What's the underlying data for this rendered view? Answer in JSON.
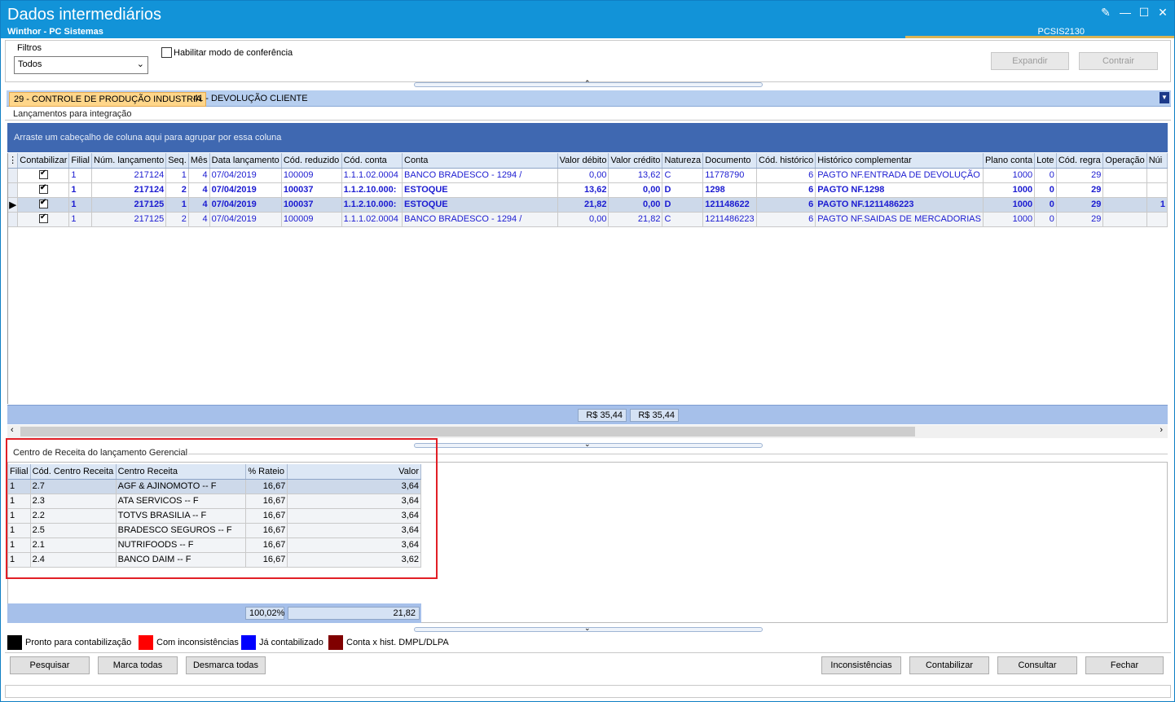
{
  "window": {
    "title": "Dados intermediários",
    "subtitle": "Winthor - PC Sistemas",
    "code": "PCSIS2130"
  },
  "filters": {
    "label": "Filtros",
    "value": "Todos",
    "conference_label": "Habilitar modo de conferência"
  },
  "top_buttons": {
    "expand": "Expandir",
    "collapse": "Contrair"
  },
  "tabs": [
    "29 - CONTROLE DE PRODUÇÃO INDUSTRIA",
    "41 - DEVOLUÇÃO CLIENTE"
  ],
  "main": {
    "section_label": "Lançamentos para integração",
    "group_hint": "Arraste um cabeçalho de coluna aqui para agrupar por essa coluna",
    "columns": [
      "Contabilizar",
      "Filial",
      "Núm. lançamento",
      "Seq.",
      "Mês",
      "Data lançamento",
      "Cód. reduzido",
      "Cód. conta",
      "Conta",
      "Valor débito",
      "Valor crédito",
      "Natureza",
      "Documento",
      "Cód. histórico",
      "Histórico complementar",
      "Plano conta",
      "Lote",
      "Cód. regra",
      "Operação",
      "Núi"
    ],
    "rows": [
      {
        "filial": "1",
        "num": "217124",
        "seq": "1",
        "mes": "4",
        "data": "07/04/2019",
        "codred": "100009",
        "codconta": "1.1.1.02.0004",
        "conta": "BANCO BRADESCO - 1294 /",
        "debito": "0,00",
        "credito": "13,62",
        "natureza": "C",
        "documento": "11778790",
        "codhist": "6",
        "hist": "PAGTO NF.ENTRADA DE DEVOLUÇÃO",
        "plano": "1000",
        "lote": "0",
        "regra": "29",
        "operacao": "",
        "nu": ""
      },
      {
        "filial": "1",
        "num": "217124",
        "seq": "2",
        "mes": "4",
        "data": "07/04/2019",
        "codred": "100037",
        "codconta": "1.1.2.10.000:",
        "conta": "ESTOQUE",
        "debito": "13,62",
        "credito": "0,00",
        "natureza": "D",
        "documento": "1298",
        "codhist": "6",
        "hist": "PAGTO NF.1298",
        "plano": "1000",
        "lote": "0",
        "regra": "29",
        "operacao": "",
        "nu": ""
      },
      {
        "filial": "1",
        "num": "217125",
        "seq": "1",
        "mes": "4",
        "data": "07/04/2019",
        "codred": "100037",
        "codconta": "1.1.2.10.000:",
        "conta": "ESTOQUE",
        "debito": "21,82",
        "credito": "0,00",
        "natureza": "D",
        "documento": "121148622",
        "codhist": "6",
        "hist": "PAGTO NF.1211486223",
        "plano": "1000",
        "lote": "0",
        "regra": "29",
        "operacao": "",
        "nu": "1"
      },
      {
        "filial": "1",
        "num": "217125",
        "seq": "2",
        "mes": "4",
        "data": "07/04/2019",
        "codred": "100009",
        "codconta": "1.1.1.02.0004",
        "conta": "BANCO BRADESCO - 1294 /",
        "debito": "0,00",
        "credito": "21,82",
        "natureza": "C",
        "documento": "1211486223",
        "codhist": "6",
        "hist": "PAGTO NF.SAIDAS DE MERCADORIAS",
        "plano": "1000",
        "lote": "0",
        "regra": "29",
        "operacao": "",
        "nu": ""
      }
    ],
    "total_debito": "R$ 35,44",
    "total_credito": "R$ 35,44"
  },
  "centro": {
    "section_label": "Centro de Receita do lançamento Gerencial",
    "columns": [
      "Filial",
      "Cód. Centro Receita",
      "Centro Receita",
      "% Rateio",
      "Valor"
    ],
    "rows": [
      {
        "filial": "1",
        "cod": "2.7",
        "nome": "AGF & AJINOMOTO -- F",
        "rateio": "16,67",
        "valor": "3,64"
      },
      {
        "filial": "1",
        "cod": "2.3",
        "nome": "ATA SERVICOS -- F",
        "rateio": "16,67",
        "valor": "3,64"
      },
      {
        "filial": "1",
        "cod": "2.2",
        "nome": "TOTVS BRASILIA -- F",
        "rateio": "16,67",
        "valor": "3,64"
      },
      {
        "filial": "1",
        "cod": "2.5",
        "nome": "BRADESCO SEGUROS -- F",
        "rateio": "16,67",
        "valor": "3,64"
      },
      {
        "filial": "1",
        "cod": "2.1",
        "nome": "NUTRIFOODS -- F",
        "rateio": "16,67",
        "valor": "3,64"
      },
      {
        "filial": "1",
        "cod": "2.4",
        "nome": "BANCO DAIM -- F",
        "rateio": "16,67",
        "valor": "3,62"
      }
    ],
    "total_rateio": "100,02%",
    "total_valor": "21,82"
  },
  "legend": [
    {
      "label": "Pronto para contabilização",
      "color": "#000000"
    },
    {
      "label": "Com inconsistências",
      "color": "#ff0000"
    },
    {
      "label": "Já contabilizado",
      "color": "#0000ff"
    },
    {
      "label": "Conta x hist. DMPL/DLPA",
      "color": "#800000"
    }
  ],
  "buttons": {
    "pesquisar": "Pesquisar",
    "marca": "Marca todas",
    "desmarca": "Desmarca todas",
    "inconsistencias": "Inconsistências",
    "contabilizar": "Contabilizar",
    "consultar": "Consultar",
    "fechar": "Fechar"
  }
}
